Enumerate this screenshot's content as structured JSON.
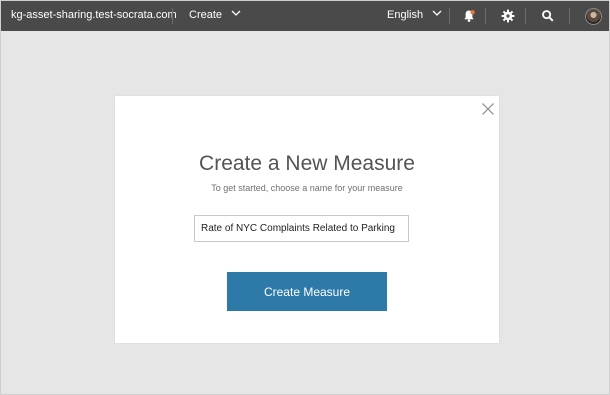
{
  "header": {
    "site_name": "kg-asset-sharing.test-socrata.com",
    "create_label": "Create",
    "language_label": "English",
    "icons": [
      "notification-bell-icon",
      "gear-icon",
      "search-icon",
      "avatar"
    ]
  },
  "modal": {
    "title": "Create a New Measure",
    "subtitle": "To get started, choose a name for your measure",
    "name_input_value": "Rate of NYC Complaints Related to Parking",
    "submit_label": "Create Measure",
    "close_icon": "close-icon"
  },
  "colors": {
    "topbar": "#4a4a4a",
    "page_background": "#e6e6e6",
    "primary_button": "#2d79a8",
    "notification_accent": "#e8743b"
  }
}
